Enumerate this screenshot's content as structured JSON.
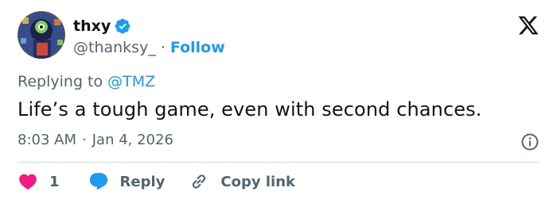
{
  "user": {
    "display_name": "thxy",
    "handle": "@thanksy_",
    "separator": "·",
    "follow_label": "Follow",
    "avatar_icon": "avatar-image"
  },
  "tweet": {
    "replying_prefix": "Replying to",
    "replying_to": "@TMZ",
    "text": "Life’s a tough game, even with second chances.",
    "time": "8:03 AM",
    "date_separator": "·",
    "date": "Jan 4, 2026"
  },
  "actions": {
    "like_count": "1",
    "reply_label": "Reply",
    "copy_label": "Copy link"
  },
  "colors": {
    "accent": "#1d9bf0",
    "like": "#f91880",
    "muted": "#536471",
    "text": "#0f1419"
  },
  "icons": [
    "verified-badge-icon",
    "x-logo-icon",
    "info-icon",
    "heart-icon",
    "reply-bubble-icon",
    "link-icon"
  ]
}
